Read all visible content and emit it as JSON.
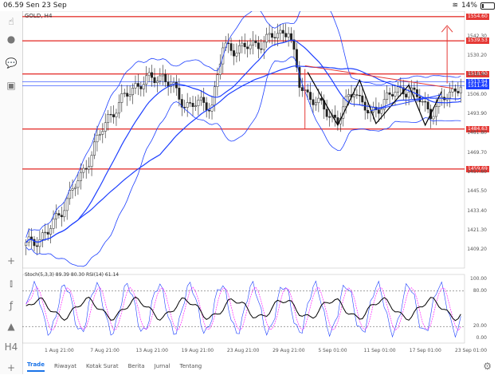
{
  "status": {
    "time": "06.59",
    "date": "Sen 23 Sep",
    "battery": "14%"
  },
  "chart": {
    "symbol": "GOLD, H4",
    "oscillator": "Stoch(5,3,3) 89.39 80.30 RSI(14) 61.14"
  },
  "price_labels": [
    {
      "text": "1554.60",
      "color": "#e53935"
    },
    {
      "text": "1539.53",
      "color": "#e53935"
    },
    {
      "text": "1518.90",
      "color": "#e53935"
    },
    {
      "text": "1513.94",
      "color": "#1e40ff"
    },
    {
      "text": "1511.46",
      "color": "#1e40ff"
    },
    {
      "text": "1484.63",
      "color": "#e53935"
    },
    {
      "text": "1459.69",
      "color": "#e53935"
    }
  ],
  "price_scale": [
    "1542.30",
    "1530.20",
    "1518.40",
    "1506.00",
    "1493.90",
    "1481.80",
    "1469.70",
    "1457.60",
    "1445.50",
    "1433.40",
    "1421.30",
    "1409.20"
  ],
  "osc_scale": [
    "100.00",
    "80.00",
    "20.00",
    "0.00"
  ],
  "time_scale": [
    "1 Aug 21:00",
    "7 Aug 21:00",
    "13 Aug 21:00",
    "19 Aug 21:00",
    "23 Aug 21:00",
    "29 Aug 21:00",
    "5 Sep 01:00",
    "11 Sep 01:00",
    "17 Sep 01:00",
    "23 Sep 01:00"
  ],
  "tabs": [
    "Trade",
    "Riwayat",
    "Kotak Surat",
    "Berita",
    "Jurnal",
    "Tentang"
  ],
  "colors": {
    "candle": "#222222",
    "band": "#1e40ff",
    "level": "#e53935",
    "stoch_main": "#000000",
    "stoch_signal": "#ff00ff"
  },
  "icons": [
    "wifi-icon",
    "cursor-icon",
    "profile-icon",
    "chat-icon",
    "new-doc-icon",
    "crosshair-icon",
    "indicators-icon",
    "function-icon",
    "objects-icon",
    "timeframe-icon",
    "add-icon",
    "settings-icon"
  ]
}
